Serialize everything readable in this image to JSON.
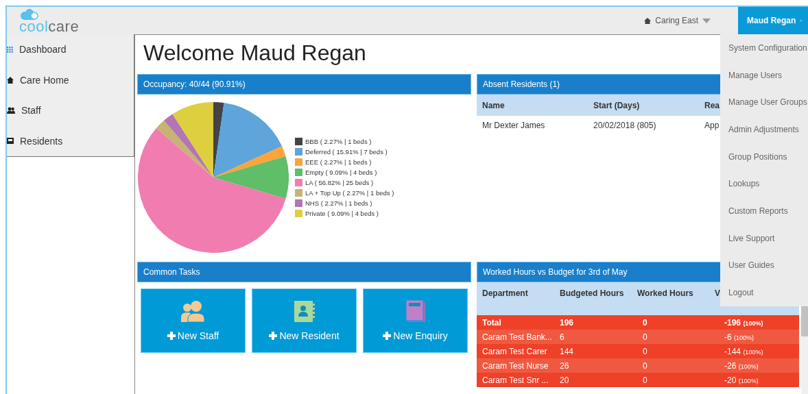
{
  "logo": {
    "parts": [
      "cool",
      "care"
    ]
  },
  "header": {
    "location": "Caring East",
    "user": "Maud Regan"
  },
  "user_menu": {
    "expanded": true,
    "items": [
      "System Configuration",
      "Manage Users",
      "Manage User Groups",
      "Admin Adjustments",
      "Group Positions",
      "Lookups",
      "Custom Reports",
      "Live Support",
      "User Guides",
      "Logout"
    ]
  },
  "sidebar": {
    "items": [
      {
        "label": "Dashboard"
      },
      {
        "label": "Care Home"
      },
      {
        "label": "Staff"
      },
      {
        "label": "Residents"
      }
    ]
  },
  "title": "Welcome Maud Regan",
  "occupancy": {
    "title": "Occupancy: 40/44 (90.91%)",
    "chart_data": {
      "type": "pie",
      "categories": [
        "BBB",
        "Deferred",
        "EEE",
        "Empty",
        "LA",
        "LA + Top Up",
        "NHS",
        "Private"
      ],
      "values": [
        2.27,
        15.91,
        2.27,
        9.09,
        56.82,
        2.27,
        2.27,
        9.09
      ],
      "colors": [
        "#434348",
        "#5da5da",
        "#faa43a",
        "#60bd68",
        "#f17cb0",
        "#c8b274",
        "#b276b2",
        "#decf3f"
      ]
    },
    "legend": [
      "( 2.27% | 1 beds )",
      "( 15.91% | 7 beds )",
      "( 2.27% | 1 beds )",
      "( 9.09% | 4 beds )",
      "( 56.82% | 25 beds )",
      "( 2.27% | 1 beds )",
      "( 2.27% | 1 beds )",
      "( 9.09% | 4 beds )"
    ]
  },
  "absent": {
    "title": "Absent Residents (1)",
    "columns": [
      "Name",
      "Start (Days)",
      "Rea"
    ],
    "rows": [
      [
        "Mr Dexter James",
        "20/02/2018 (805)",
        "App"
      ]
    ]
  },
  "tasks": {
    "title": "Common Tasks",
    "items": [
      {
        "label": "New Staff"
      },
      {
        "label": "New Resident"
      },
      {
        "label": "New Enquiry"
      }
    ]
  },
  "hours": {
    "title": "Worked Hours vs Budget for 3rd of May",
    "columns": [
      "Department",
      "Budgeted Hours",
      "Worked Hours",
      "V"
    ],
    "rows": [
      {
        "kind": "total",
        "department": "Total",
        "budgeted": "196",
        "worked": "0",
        "variance": "-196",
        "variance_pct": "(100%)",
        "color": "#ef4128"
      },
      {
        "kind": "row",
        "department": "Caram Test Bank...",
        "budgeted": "6",
        "worked": "0",
        "variance": "-6",
        "variance_pct": "(100%)",
        "color": "#f05941"
      },
      {
        "kind": "row",
        "department": "Caram Test Carer",
        "budgeted": "144",
        "worked": "0",
        "variance": "-144",
        "variance_pct": "(100%)",
        "color": "#ef4128"
      },
      {
        "kind": "row",
        "department": "Caram Test Nurse",
        "budgeted": "26",
        "worked": "0",
        "variance": "-26",
        "variance_pct": "(100%)",
        "color": "#f05941"
      },
      {
        "kind": "row",
        "department": "Caram Test Snr ...",
        "budgeted": "20",
        "worked": "0",
        "variance": "-20",
        "variance_pct": "(100%)",
        "color": "#ef4128"
      }
    ]
  }
}
